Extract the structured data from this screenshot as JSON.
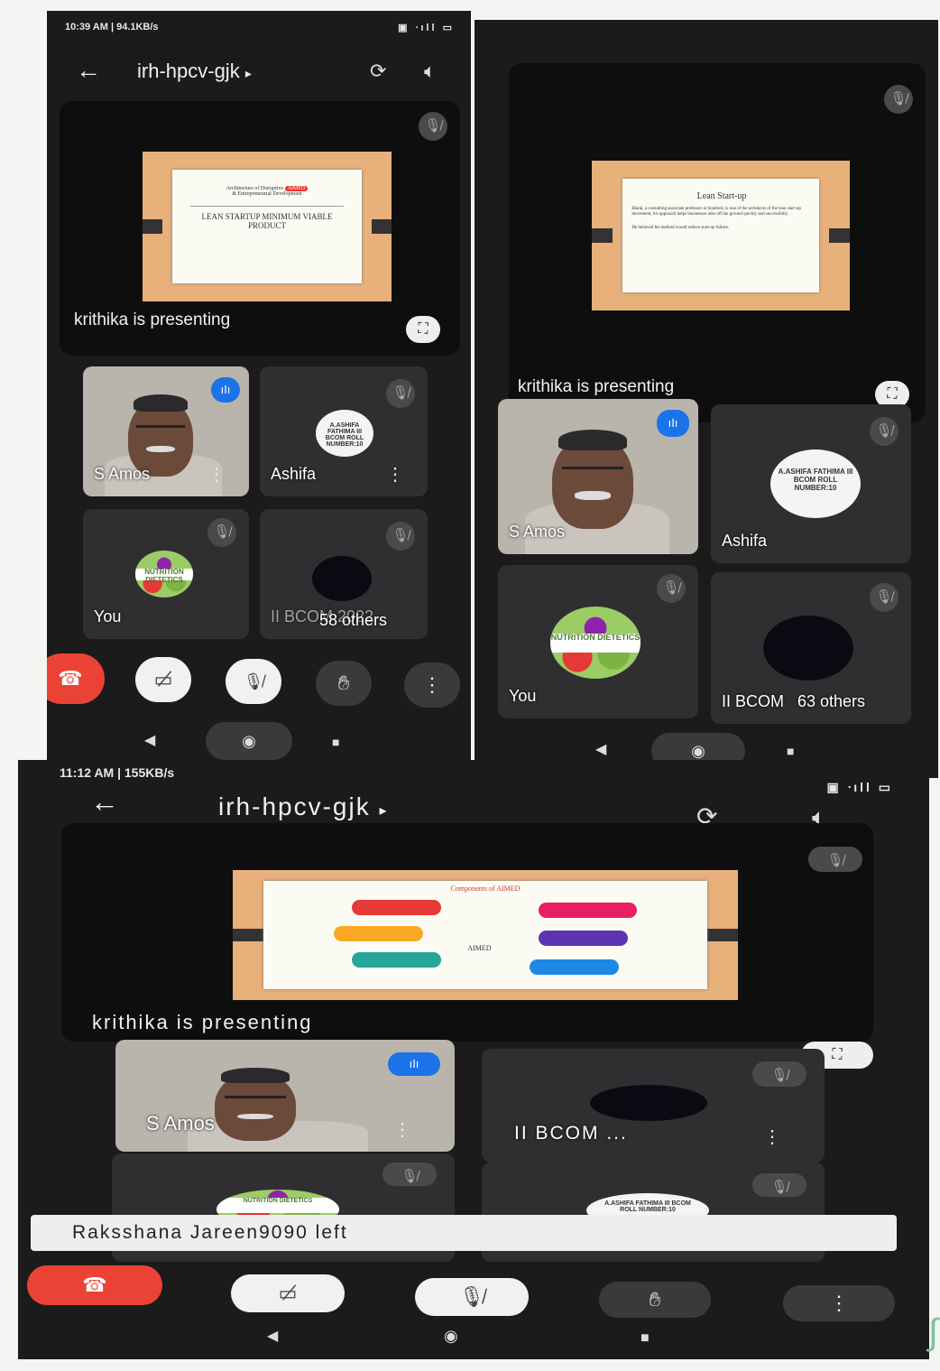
{
  "shot1": {
    "time": "10:39 AM | 94.1KB/s",
    "status_icons": "▣ ᐧıll ▭",
    "meeting_code": "irh-hpcv-gjk",
    "slide": {
      "line1": "Architecture of Disruptive",
      "line2": "& Entrepreneurial Development",
      "logo": "AIMED",
      "title": "LEAN STARTUP MINIMUM VIABLE PRODUCT"
    },
    "presenting": "krithika is presenting",
    "tiles": [
      {
        "name": "S Amos"
      },
      {
        "name": "Ashifa",
        "avatar": "A.ASHIFA FATHIMA III BCOM ROLL NUMBER:10"
      },
      {
        "name": "You",
        "avatar": "NUTRITION DIETETICS"
      },
      {
        "name": "II BCOM 2022",
        "others": "58 others"
      }
    ]
  },
  "shot2": {
    "slide": {
      "title": "Lean Start-up",
      "bullet1": "Blank, a consulting associate professor at Stanford, is one of the architects of the lean start-up movement, his approach helps businesses take off the ground quickly and successfully.",
      "bullet2": "He believed his method would reduce start-up failure."
    },
    "presenting": "krithika is presenting",
    "tiles": [
      {
        "name": "S Amos"
      },
      {
        "name": "Ashifa",
        "avatar": "A.ASHIFA FATHIMA III BCOM ROLL NUMBER:10"
      },
      {
        "name": "You",
        "avatar": "NUTRITION DIETETICS"
      },
      {
        "name": "II BCOM",
        "others": "63 others"
      }
    ]
  },
  "shot3": {
    "time": "11:12 AM | 155KB/s",
    "status_icons": "▣ ᐧıll ▭",
    "meeting_code": "irh-hpcv-gjk",
    "slide": {
      "title": "Components of AIMED",
      "logo": "AIMED"
    },
    "presenting": "krithika is presenting",
    "tiles": [
      {
        "name": "S Amos"
      },
      {
        "name": "II BCOM ..."
      },
      {
        "avatar": "NUTRITION DIETETICS"
      },
      {
        "avatar": "A.ASHIFA FATHIMA III BCOM ROLL NUMBER:10"
      }
    ],
    "toast": "Raksshana Jareen9090 left"
  },
  "icons": {
    "back": "←",
    "dropdown": "▸",
    "rotate": "⟳",
    "speaker": "🔈︎",
    "mic_off": "🎙︎̸",
    "fullscreen": "⛶",
    "more": "⋮",
    "end_call": "☎︎",
    "cam_off": "▭̸",
    "hand": "✋︎",
    "nav_back": "◀",
    "nav_home": "◉",
    "nav_recent": "■",
    "speaking": "ıIı"
  },
  "colors": {
    "end_call": "#ea4335",
    "speaking": "#1a73e8"
  }
}
